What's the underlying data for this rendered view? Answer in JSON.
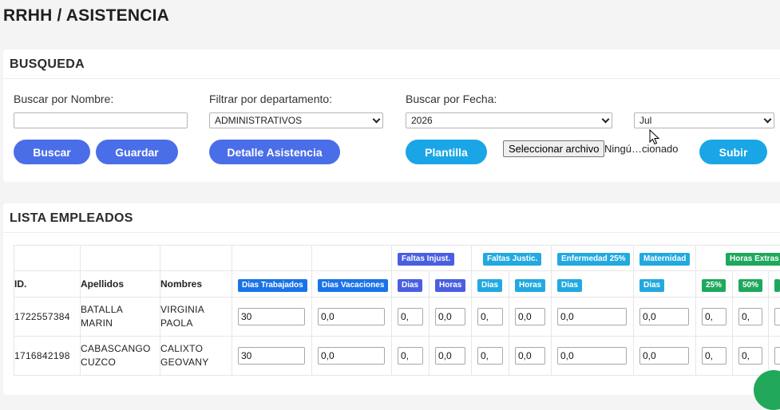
{
  "page": {
    "title": "RRHH / ASISTENCIA"
  },
  "search": {
    "header": "BUSQUEDA",
    "name_label": "Buscar por Nombre:",
    "name_value": "",
    "dept_label": "Filtrar por departamento:",
    "dept_selected": "ADMINISTRATIVOS",
    "date_label": "Buscar por Fecha:",
    "year_selected": "2026",
    "month_selected": "Jul",
    "buscar_label": "Buscar",
    "guardar_label": "Guardar",
    "detalle_label": "Detalle Asistencia",
    "plantilla_label": "Plantilla",
    "file_button_label": "Seleccionar archivo",
    "file_status": "Ningú…cionado",
    "subir_label": "Subir"
  },
  "list": {
    "header": "LISTA EMPLEADOS",
    "groups": {
      "faltas_injust": "Faltas Injust.",
      "faltas_justic": "Faltas Justic.",
      "enfermedad": "Enfermedad 25%",
      "maternidad": "Maternidad",
      "horas_extras": "Horas Extras"
    },
    "columns": {
      "id": "ID.",
      "apellidos": "Apellidos",
      "nombres": "Nombres",
      "dias_trabajados": "Dias Trabajados",
      "dias_vacaciones": "Dias Vacaciones",
      "dias": "Dias",
      "horas": "Horas",
      "p25": "25%",
      "p50": "50%"
    },
    "rows": [
      {
        "id": "1722557384",
        "apellidos": [
          "BATALLA",
          "MARIN"
        ],
        "nombres": [
          "VIRGINIA",
          "PAOLA"
        ],
        "dias_trabajados": "30",
        "dias_vacaciones": "0,0",
        "fi_dias": "0,",
        "fi_horas": "0,0",
        "fj_dias": "0,",
        "fj_horas": "0,0",
        "enf_dias": "0,0",
        "mat_dias": "0,0",
        "he_25": "0,",
        "he_50": "0,"
      },
      {
        "id": "1716842198",
        "apellidos": [
          "CABASCANGO",
          "CUZCO"
        ],
        "nombres": [
          "CALIXTO",
          "GEOVANY"
        ],
        "dias_trabajados": "30",
        "dias_vacaciones": "0,0",
        "fi_dias": "0,",
        "fi_horas": "0,0",
        "fj_dias": "0,",
        "fj_horas": "0,0",
        "enf_dias": "0,0",
        "mat_dias": "0,0",
        "he_25": "0,",
        "he_50": "0,"
      }
    ]
  },
  "colors": {
    "primary": "#4a6ee8",
    "info": "#1aa6e6",
    "badge_blue": "#1a73e8",
    "badge_indigo": "#4a5fe0",
    "badge_cyan": "#22a9e0",
    "badge_green": "#1fa85c"
  }
}
